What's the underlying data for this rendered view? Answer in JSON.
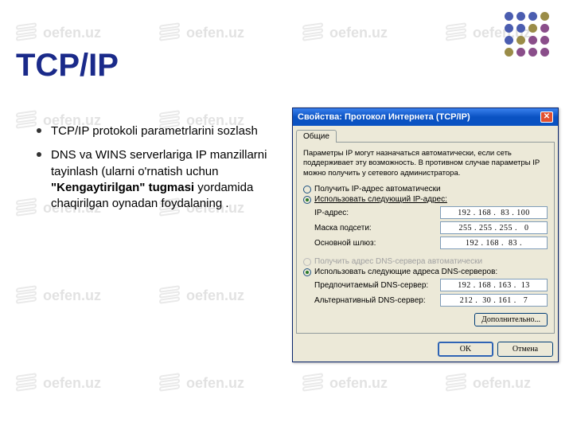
{
  "watermark_text": "oefen.uz",
  "logo_colors": [
    "#4b5db0",
    "#4b5db0",
    "#4b5db0",
    "#9a8c48",
    "#4b5db0",
    "#4b5db0",
    "#9a8c48",
    "#8a4e8a",
    "#4b5db0",
    "#9a8c48",
    "#8a4e8a",
    "#8a4e8a",
    "#9a8c48",
    "#8a4e8a",
    "#8a4e8a",
    "#8a4e8a"
  ],
  "title": "TCP/IP",
  "bullets": [
    {
      "text": "TCP/IP protokoli parametrlarini sozlash"
    },
    {
      "pre": "DNS va WINS serverlariga IP manzillarni tayinlash (ularni o'rnatish uchun ",
      "bold": "\"Kengaytirilgan\" tugmasi",
      "post": " yordamida chaqirilgan oynadan foydalaning ."
    }
  ],
  "dialog": {
    "title": "Свойства: Протокол Интернета (TCP/IP)",
    "tab": "Общие",
    "description": "Параметры IP могут назначаться автоматически, если сеть поддерживает эту возможность. В противном случае параметры IP можно получить у сетевого администратора.",
    "radio_auto_ip": "Получить IP-адрес автоматически",
    "radio_manual_ip": "Использовать следующий IP-адрес:",
    "label_ip": "IP-адрес:",
    "value_ip": "192 . 168 .  83 . 100",
    "label_mask": "Маска подсети:",
    "value_mask": "255 . 255 . 255 .   0",
    "label_gw": "Основной шлюз:",
    "value_gw": "192 . 168 .  83 .",
    "radio_auto_dns": "Получить адрес DNS-сервера автоматически",
    "radio_manual_dns": "Использовать следующие адреса DNS-серверов:",
    "label_dns1": "Предпочитаемый DNS-сервер:",
    "value_dns1": "192 . 168 . 163 .  13",
    "label_dns2": "Альтернативный DNS-сервер:",
    "value_dns2": "212 .  30 . 161 .   7",
    "btn_more": "Дополнительно...",
    "btn_ok": "OK",
    "btn_cancel": "Отмена"
  }
}
